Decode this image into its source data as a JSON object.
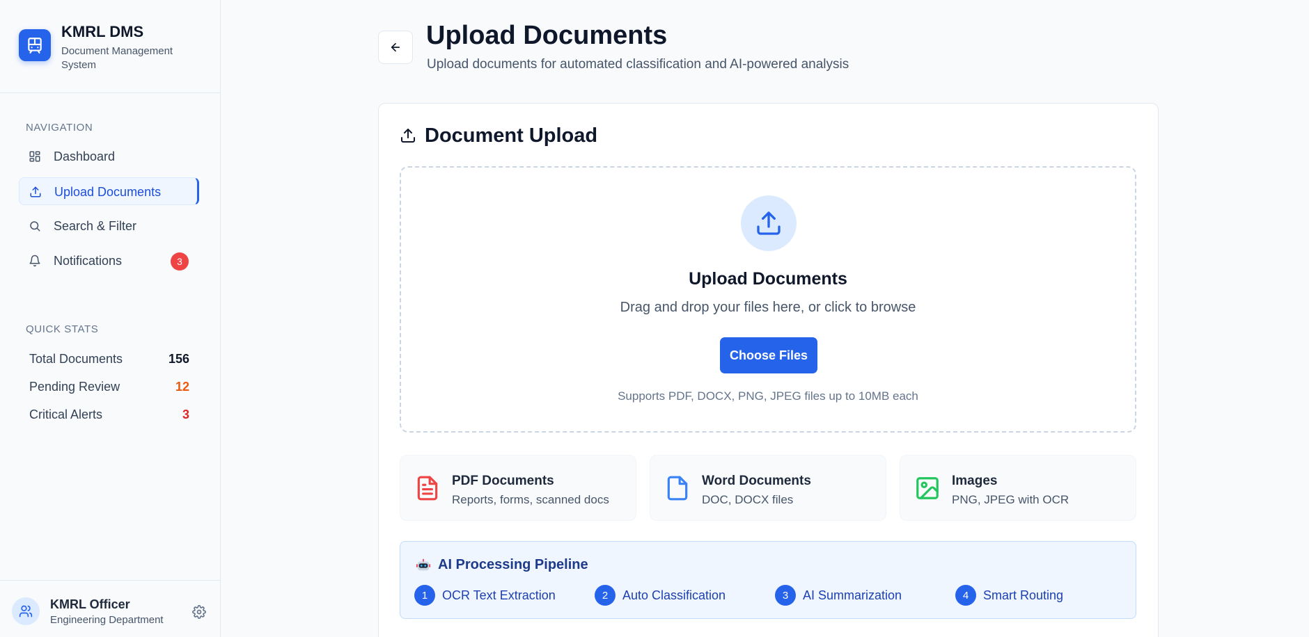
{
  "app": {
    "name": "KMRL DMS",
    "subtitle": "Document Management System"
  },
  "sidebar": {
    "nav_section_label": "NAVIGATION",
    "nav_items": [
      {
        "label": "Dashboard",
        "icon": "grid-icon"
      },
      {
        "label": "Upload Documents",
        "icon": "upload-icon",
        "active": true
      },
      {
        "label": "Search & Filter",
        "icon": "search-icon"
      },
      {
        "label": "Notifications",
        "icon": "bell-icon",
        "badge": "3"
      }
    ],
    "stats_section_label": "QUICK STATS",
    "stats": [
      {
        "label": "Total Documents",
        "value": "156",
        "color": "#0f172a"
      },
      {
        "label": "Pending Review",
        "value": "12",
        "color": "#ea580c"
      },
      {
        "label": "Critical Alerts",
        "value": "3",
        "color": "#dc2626"
      }
    ],
    "user": {
      "name": "KMRL Officer",
      "department": "Engineering Department"
    }
  },
  "header": {
    "title": "Upload Documents",
    "subtitle": "Upload documents for automated classification and AI-powered analysis"
  },
  "upload_card": {
    "title": "Document Upload",
    "dropzone": {
      "title": "Upload Documents",
      "subtitle": "Drag and drop your files here, or click to browse",
      "button_label": "Choose Files",
      "note": "Supports PDF, DOCX, PNG, JPEG files up to 10MB each"
    },
    "file_types": [
      {
        "title": "PDF Documents",
        "subtitle": "Reports, forms, scanned docs",
        "icon": "file-text-icon",
        "color": "#ef4444"
      },
      {
        "title": "Word Documents",
        "subtitle": "DOC, DOCX files",
        "icon": "file-icon",
        "color": "#3b82f6"
      },
      {
        "title": "Images",
        "subtitle": "PNG, JPEG with OCR",
        "icon": "image-icon",
        "color": "#22c55e"
      }
    ],
    "pipeline": {
      "title": "AI Processing Pipeline",
      "icon": "robot-icon",
      "steps": [
        {
          "num": "1",
          "label": "OCR Text Extraction"
        },
        {
          "num": "2",
          "label": "Auto Classification"
        },
        {
          "num": "3",
          "label": "AI Summarization"
        },
        {
          "num": "4",
          "label": "Smart Routing"
        }
      ]
    }
  },
  "colors": {
    "accent": "#2563eb",
    "badge": "#ef4444"
  }
}
